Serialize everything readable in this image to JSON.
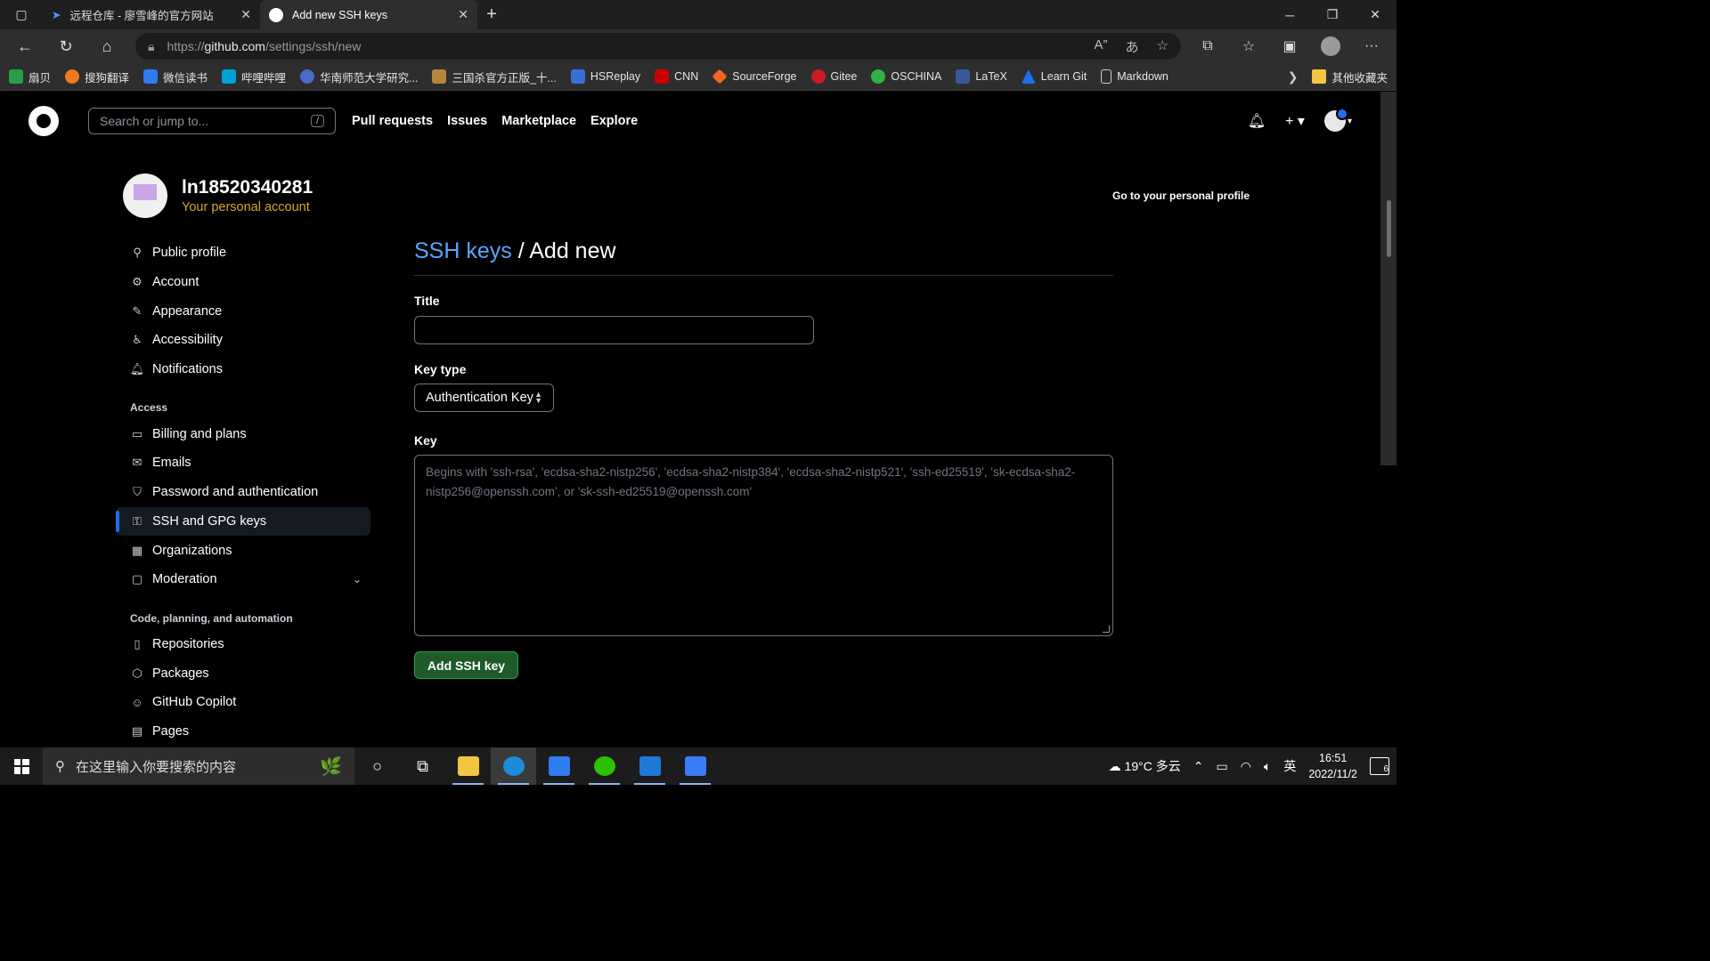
{
  "browser": {
    "tabs": [
      {
        "title": "远程仓库 - 廖雪峰的官方网站",
        "active": false,
        "icon": "rocket-icon"
      },
      {
        "title": "Add new SSH keys",
        "active": true,
        "icon": "github-icon"
      }
    ],
    "url_prefix": "https://",
    "url_host": "github.com",
    "url_path": "/settings/ssh/new",
    "bookmarks": [
      {
        "label": "扇贝",
        "color": "#2a9d4f"
      },
      {
        "label": "搜狗翻译",
        "color": "#f07a1f"
      },
      {
        "label": "微信读书",
        "color": "#2f7bf0"
      },
      {
        "label": "哔哩哔哩",
        "color": "#00a1d6"
      },
      {
        "label": "华南师范大学研究...",
        "color": "#4a6bc9"
      },
      {
        "label": "三国杀官方正版_十...",
        "color": "#b8863b"
      },
      {
        "label": "HSReplay",
        "color": "#3b6fd8"
      },
      {
        "label": "CNN",
        "color": "#cc0000"
      },
      {
        "label": "SourceForge",
        "color": "#f26522"
      },
      {
        "label": "Gitee",
        "color": "#c71d23"
      },
      {
        "label": "OSCHINA",
        "color": "#2fb344"
      },
      {
        "label": "LaTeX",
        "color": "#3b5998"
      },
      {
        "label": "Learn Git",
        "color": "#1e6fe8"
      },
      {
        "label": "Markdown",
        "color": "#cccccc"
      }
    ],
    "bookmarks_folder": "其他收藏夹"
  },
  "github": {
    "search_placeholder": "Search or jump to...",
    "search_shortcut": "/",
    "nav": [
      "Pull requests",
      "Issues",
      "Marketplace",
      "Explore"
    ],
    "username": "ln18520340281",
    "account_type": "Your personal account",
    "goto_profile": "Go to your personal profile",
    "sidebar": {
      "group1": [
        {
          "label": "Public profile",
          "icon": "person-icon"
        },
        {
          "label": "Account",
          "icon": "gear-icon"
        },
        {
          "label": "Appearance",
          "icon": "paintbrush-icon"
        },
        {
          "label": "Accessibility",
          "icon": "accessibility-icon"
        },
        {
          "label": "Notifications",
          "icon": "bell-icon"
        }
      ],
      "access_heading": "Access",
      "group2": [
        {
          "label": "Billing and plans",
          "icon": "credit-card-icon"
        },
        {
          "label": "Emails",
          "icon": "mail-icon"
        },
        {
          "label": "Password and authentication",
          "icon": "shield-icon"
        },
        {
          "label": "SSH and GPG keys",
          "icon": "key-icon",
          "selected": true
        },
        {
          "label": "Organizations",
          "icon": "organization-icon"
        },
        {
          "label": "Moderation",
          "icon": "report-icon"
        }
      ],
      "code_heading": "Code, planning, and automation",
      "group3": [
        {
          "label": "Repositories",
          "icon": "repo-icon"
        },
        {
          "label": "Packages",
          "icon": "package-icon"
        },
        {
          "label": "GitHub Copilot",
          "icon": "copilot-icon"
        },
        {
          "label": "Pages",
          "icon": "browser-icon"
        }
      ]
    },
    "main": {
      "breadcrumb": "SSH keys",
      "separator": "/",
      "title": "Add new",
      "title_label": "Title",
      "title_value": "",
      "keytype_label": "Key type",
      "keytype_value": "Authentication Key",
      "key_label": "Key",
      "key_placeholder": "Begins with 'ssh-rsa', 'ecdsa-sha2-nistp256', 'ecdsa-sha2-nistp384', 'ecdsa-sha2-nistp521', 'ssh-ed25519', 'sk-ecdsa-sha2-nistp256@openssh.com', or 'sk-ssh-ed25519@openssh.com'",
      "submit_label": "Add SSH key"
    }
  },
  "taskbar": {
    "search_placeholder": "在这里输入你要搜索的内容",
    "weather": "19°C 多云",
    "ime": "英",
    "time": "16:51",
    "date": "2022/11/2",
    "notification_count": "6"
  }
}
